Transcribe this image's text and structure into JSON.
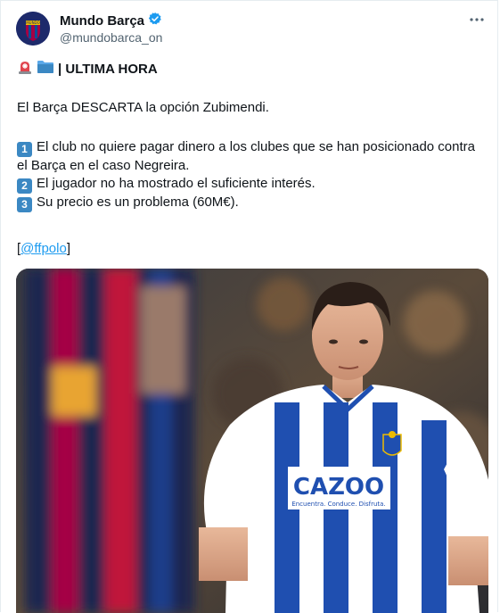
{
  "author": {
    "name": "Mundo Barça",
    "handle": "@mundobarca_on",
    "avatar_text": "MUNDO"
  },
  "tweet": {
    "breaking_label": "| ULTIMA HORA",
    "headline": "El Barça DESCARTA la opción Zubimendi.",
    "points": [
      {
        "key": "1",
        "text": "El club no quiere pagar dinero a los clubes que se han posicionado contra el Barça en el caso Negreira."
      },
      {
        "key": "2",
        "text": "El jugador no ha mostrado el suficiente interés."
      },
      {
        "key": "3",
        "text": "Su precio es un problema (60M€)."
      }
    ],
    "credit_open": "[",
    "credit_link": "@ffpolo",
    "credit_close": "]"
  },
  "media": {
    "jersey_sponsor": "CAZOO",
    "jersey_tagline": "Encuentra. Conduce. Disfruta."
  },
  "colors": {
    "verified": "#1d9bf0",
    "link": "#1d9bf0",
    "keycap": "#3b88c3",
    "handle_gray": "#536471"
  },
  "icons": {
    "more": "ellipsis-icon",
    "siren": "siren-icon",
    "folder": "folder-icon",
    "verified": "verified-badge-icon"
  }
}
